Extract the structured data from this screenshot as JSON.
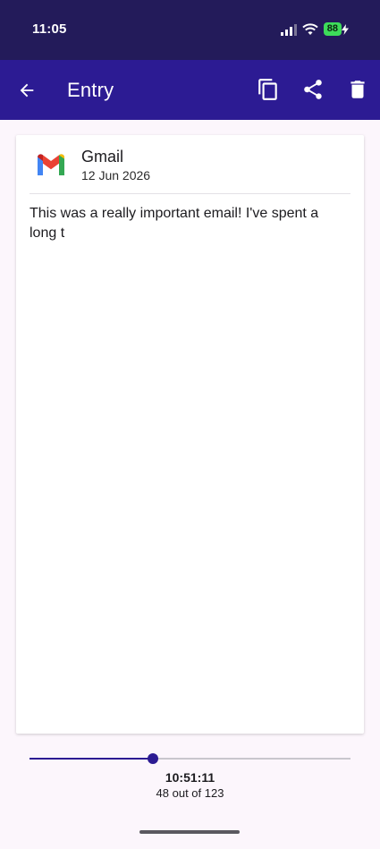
{
  "status_bar": {
    "time": "11:05",
    "battery_level": "88",
    "signal_icon": "cellular-signal-icon",
    "wifi_icon": "wifi-icon",
    "charging_icon": "charging-bolt-icon"
  },
  "app_bar": {
    "title": "Entry",
    "back_icon": "arrow-back-icon",
    "actions": [
      {
        "name": "copy",
        "icon": "copy-icon"
      },
      {
        "name": "share",
        "icon": "share-icon"
      },
      {
        "name": "delete",
        "icon": "trash-icon"
      }
    ]
  },
  "entry": {
    "app_name": "Gmail",
    "app_icon": "gmail-logo-icon",
    "date": "12 Jun 2026",
    "body": "This was a really important email! I've spent a long t"
  },
  "navigator": {
    "current_index": 48,
    "total": 123,
    "timestamp": "10:51:11",
    "position_label": "48 out of 123"
  },
  "colors": {
    "status_bar_bg": "#231b5a",
    "app_bar_bg": "#2c1b93",
    "accent": "#2c1b93",
    "page_bg": "#fcf6fc",
    "battery_green": "#3ddc5a"
  }
}
